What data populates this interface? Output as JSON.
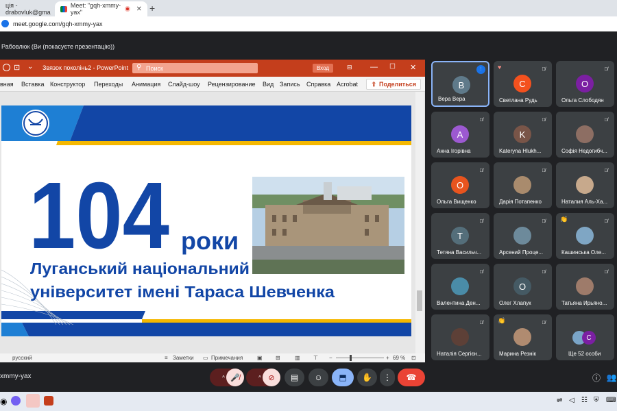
{
  "browser": {
    "tabs": [
      {
        "label": "ція - drabovluk@gma",
        "close": "✕"
      },
      {
        "label": "Meet: \"gqh-xmmy-yax\"",
        "close": "✕"
      }
    ],
    "newtab": "+",
    "url": "meet.google.com/gqh-xmmy-yax"
  },
  "meet": {
    "presenting_label": "Рабовлюк (Ви (покасуєте презентацію))",
    "meeting_code": "xmmy-yax"
  },
  "powerpoint": {
    "doc_title": "Звязок поколінь2 - PowerPoint",
    "search_placeholder": "Поиск",
    "login_button": "Вход",
    "ribbon_tabs": [
      "вная",
      "Вставка",
      "Конструктор",
      "Переходы",
      "Анимация",
      "Слайд-шоу",
      "Рецензирование",
      "Вид",
      "Запись",
      "Справка",
      "Acrobat"
    ],
    "share_label": "Поделиться",
    "status": {
      "language": "русский",
      "notes": "Заметки",
      "comments": "Примечания",
      "zoom": "69 %"
    }
  },
  "slide": {
    "big_number": "104",
    "years_word": "роки",
    "line1": "Луганський національний",
    "line2": "університет імені Тараса Шевченка"
  },
  "participants": [
    {
      "name": "Вера Вера",
      "initial": "B",
      "color": "#5f7a8a",
      "active": true,
      "mic": "speaking"
    },
    {
      "name": "Светлана Рудь",
      "initial": "C",
      "color": "#f4511e",
      "mic": "muted",
      "badge": "♥"
    },
    {
      "name": "Ольга Слободян",
      "initial": "O",
      "color": "#7b1fa2",
      "mic": "muted"
    },
    {
      "name": "Анна Ігорівна",
      "initial": "A",
      "color": "#9c59d1",
      "mic": "muted"
    },
    {
      "name": "Kateryna Hlukh...",
      "initial": "K",
      "color": "#795548",
      "mic": "muted"
    },
    {
      "name": "Софія Недогибч...",
      "initial": "",
      "color": "#8d6e63",
      "mic": "muted",
      "photo": true
    },
    {
      "name": "Ольга Вищенко",
      "initial": "O",
      "color": "#e8541e",
      "mic": "muted"
    },
    {
      "name": "Дарія Потапенко",
      "initial": "",
      "color": "#a98b6d",
      "mic": "muted",
      "photo": true
    },
    {
      "name": "Наталия Аль-Ха...",
      "initial": "",
      "color": "#c7a98c",
      "mic": "muted",
      "photo": true
    },
    {
      "name": "Тетяна Васильч...",
      "initial": "T",
      "color": "#546e7a",
      "mic": "muted"
    },
    {
      "name": "Арсений Проце...",
      "initial": "",
      "color": "#6d8a9b",
      "mic": "muted",
      "photo": true
    },
    {
      "name": "Кашинська Оле...",
      "initial": "",
      "color": "#7fa6c4",
      "mic": "muted",
      "photo": true,
      "badge": "👏"
    },
    {
      "name": "Валентина Ден...",
      "initial": "",
      "color": "#4a8ca8",
      "mic": "muted",
      "photo": true
    },
    {
      "name": "Олег Хлапук",
      "initial": "O",
      "color": "#455a64",
      "mic": "muted"
    },
    {
      "name": "Татьяна Ирьяно...",
      "initial": "",
      "color": "#9e7b6a",
      "mic": "muted",
      "photo": true
    },
    {
      "name": "Наталія Сергієн...",
      "initial": "",
      "color": "#5d4037",
      "mic": "muted",
      "photo": true
    },
    {
      "name": "Марина Резнік",
      "initial": "",
      "color": "#b08b70",
      "mic": "muted",
      "photo": true,
      "badge": "👏"
    },
    {
      "name": "Ще 52 особи",
      "initial": "C",
      "color": "#7b1fa2",
      "mic": "none",
      "more": true
    }
  ],
  "colors": {
    "meet_bg": "#202124",
    "tile_bg": "#3c4043",
    "pp_red": "#c43e1c",
    "slide_blue": "#1246a6",
    "slide_yellow": "#f5b800",
    "end_call_red": "#ea4335",
    "present_blue": "#8ab4f8"
  },
  "icons": {
    "mic_muted": "mic-off-icon",
    "camera_off": "camera-off-icon",
    "captions": "captions-icon",
    "emoji": "emoji-icon",
    "present": "present-icon",
    "hand": "raise-hand-icon",
    "more": "more-vert-icon",
    "end_call": "end-call-icon",
    "info": "info-icon",
    "people": "people-icon"
  }
}
